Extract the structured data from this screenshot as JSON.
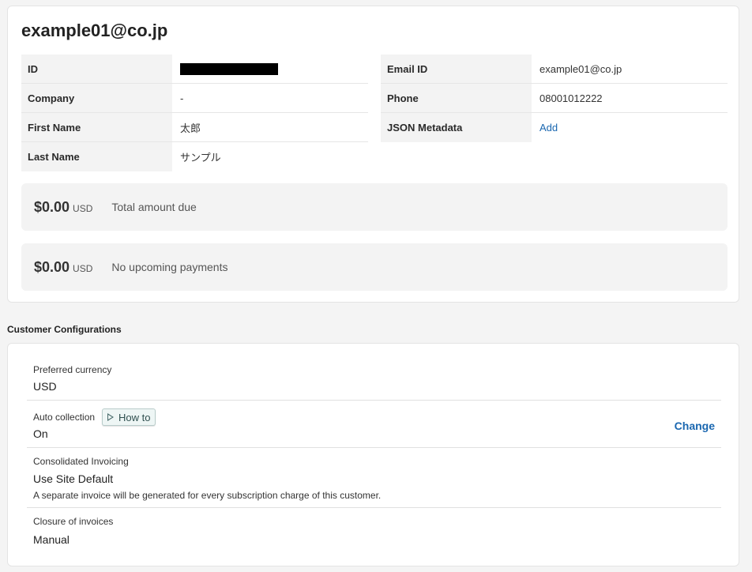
{
  "customer": {
    "title": "example01@co.jp",
    "left_details": [
      {
        "label": "ID",
        "value": "",
        "redacted": true
      },
      {
        "label": "Company",
        "value": "-"
      },
      {
        "label": "First Name",
        "value": "太郎"
      },
      {
        "label": "Last Name",
        "value": "サンプル"
      }
    ],
    "right_details": [
      {
        "label": "Email ID",
        "value": "example01@co.jp"
      },
      {
        "label": "Phone",
        "value": "08001012222"
      },
      {
        "label": "JSON Metadata",
        "value": "Add",
        "is_link": true
      }
    ]
  },
  "balances": [
    {
      "amount": "$0.00",
      "currency": "USD",
      "label": "Total amount due"
    },
    {
      "amount": "$0.00",
      "currency": "USD",
      "label": "No upcoming payments"
    }
  ],
  "config": {
    "heading": "Customer Configurations",
    "preferred_currency": {
      "label": "Preferred currency",
      "value": "USD"
    },
    "auto_collection": {
      "label": "Auto collection",
      "value": "On",
      "howto_label": "How to",
      "change_label": "Change"
    },
    "consolidated_invoicing": {
      "label": "Consolidated Invoicing",
      "value": "Use Site Default",
      "description": "A separate invoice will be generated for every subscription charge of this customer."
    },
    "closure_of_invoices": {
      "label": "Closure of invoices",
      "value": "Manual"
    }
  },
  "colors": {
    "link": "#1a67b0",
    "page_background": "#f4f4f4",
    "card_background": "#ffffff",
    "label_background": "#f3f3f3",
    "howto_background": "#eef6f5"
  },
  "icons": {
    "howto": "play-icon"
  }
}
